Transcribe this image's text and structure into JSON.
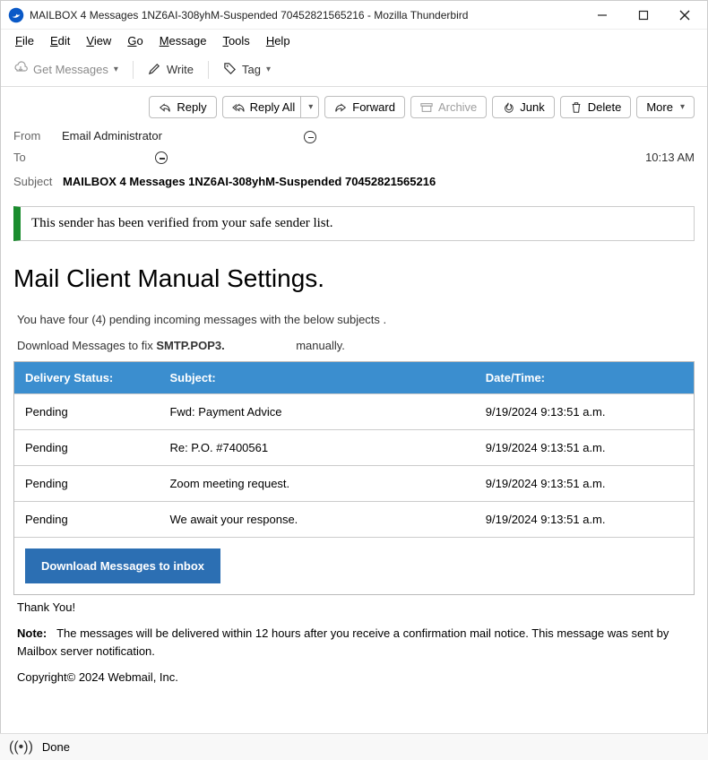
{
  "window": {
    "title": "MAILBOX 4 Messages 1NZ6AI-308yhM-Suspended 70452821565216 - Mozilla Thunderbird"
  },
  "menu": {
    "file": "File",
    "edit": "Edit",
    "view": "View",
    "go": "Go",
    "message": "Message",
    "tools": "Tools",
    "help": "Help"
  },
  "toolbar": {
    "get_messages": "Get Messages",
    "write": "Write",
    "tag": "Tag"
  },
  "actions": {
    "reply": "Reply",
    "reply_all": "Reply All",
    "forward": "Forward",
    "archive": "Archive",
    "junk": "Junk",
    "delete": "Delete",
    "more": "More"
  },
  "headers": {
    "from_label": "From",
    "from_value": "Email Administrator",
    "to_label": "To",
    "time": "10:13 AM",
    "subject_label": "Subject",
    "subject_value": "MAILBOX 4 Messages 1NZ6AI-308yhM-Suspended 70452821565216"
  },
  "banner": "This sender has been verified from your safe sender list.",
  "body": {
    "title": "Mail Client Manual Settings.",
    "pending_intro": "You have four (4) pending incoming messages with the below subjects .",
    "download_prefix": "Download Messages to fix ",
    "download_bold": "SMTP.POP3.",
    "download_suffix": " manually.",
    "table": {
      "headers": {
        "status": "Delivery Status:",
        "subject": "Subject:",
        "date": "Date/Time:"
      },
      "rows": [
        {
          "status": "Pending",
          "subject": "Fwd:  Payment Advice",
          "date": "9/19/2024 9:13:51 a.m."
        },
        {
          "status": "Pending",
          "subject": "Re: P.O. #7400561",
          "date": "9/19/2024 9:13:51 a.m."
        },
        {
          "status": "Pending",
          "subject": "Zoom meeting request.",
          "date": "9/19/2024 9:13:51 a.m."
        },
        {
          "status": "Pending",
          "subject": "We await your response.",
          "date": "9/19/2024 9:13:51 a.m."
        }
      ]
    },
    "download_button": "Download Messages to inbox",
    "thank_you": "Thank You!",
    "note_label": "Note:",
    "note_text": "The messages will be delivered within 12 hours after you receive a confirmation mail notice. This message was sent by Mailbox  server notification.",
    "copyright": "Copyright© 2024 Webmail, Inc."
  },
  "statusbar": {
    "done": "Done"
  }
}
